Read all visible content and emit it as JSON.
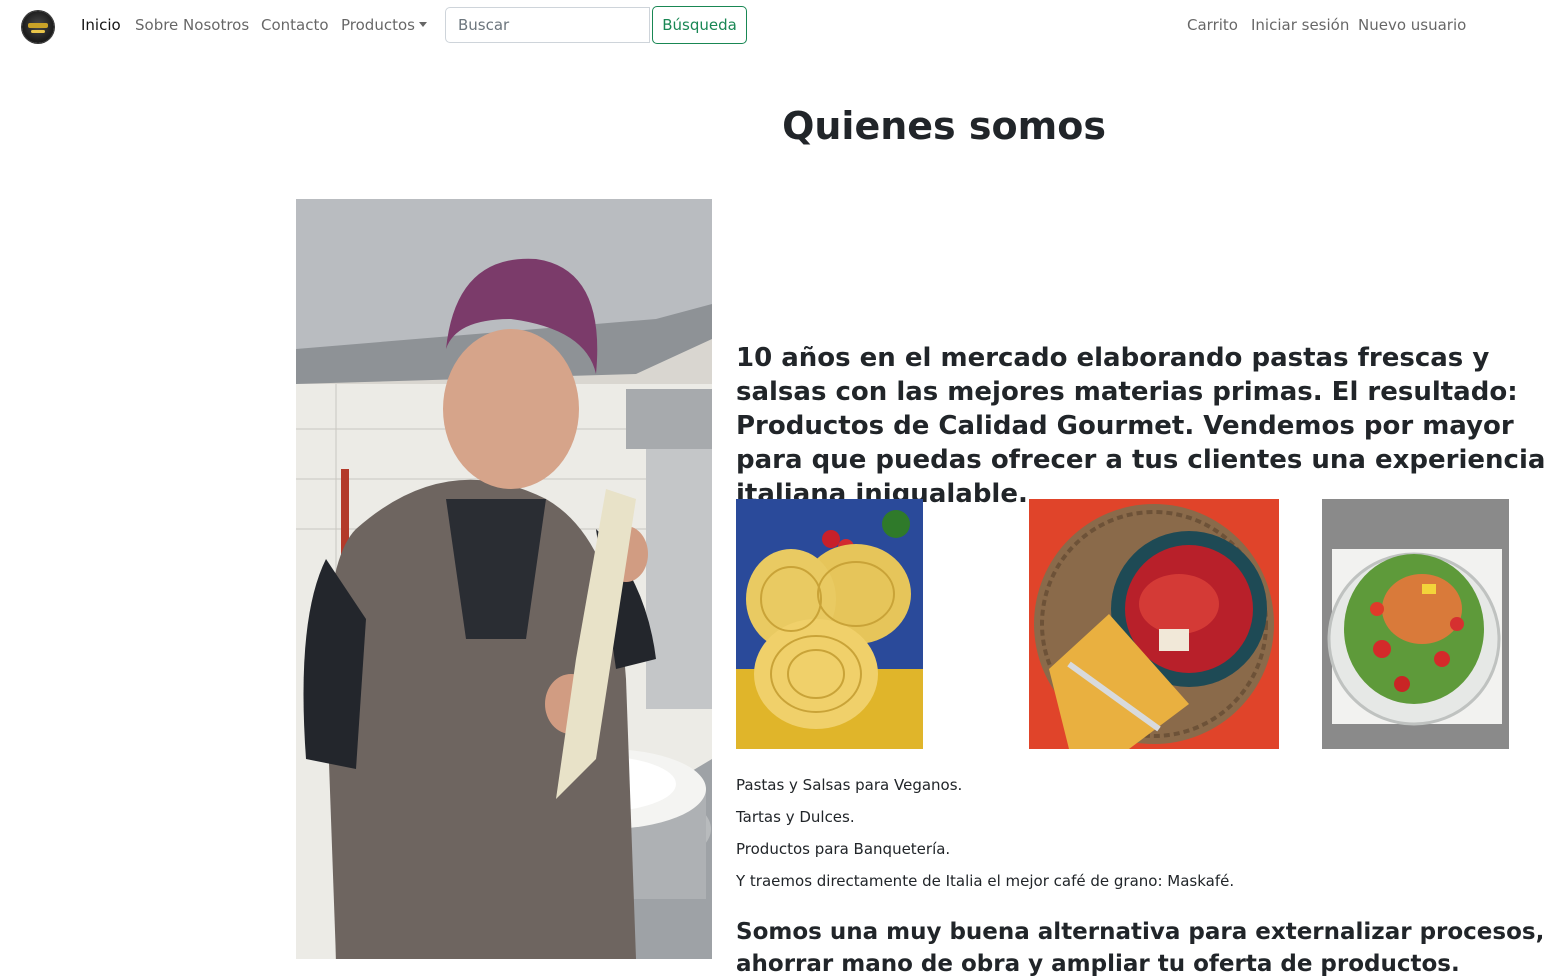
{
  "navbar": {
    "brand_logo_icon": "pasta-brand-logo",
    "links": {
      "home": "Inicio",
      "about": "Sobre Nosotros",
      "contact": "Contacto",
      "products": "Productos"
    },
    "search": {
      "placeholder": "Buscar",
      "button": "Búsqueda"
    },
    "right_links": {
      "cart": "Carrito",
      "login": "Iniciar sesión",
      "register": "Nuevo usuario"
    }
  },
  "page": {
    "title": "Quienes somos",
    "lead": "10 años en el mercado elaborando pastas frescas y salsas con las mejores materias primas. El resultado: Productos de Calidad Gourmet. Vendemos por mayor para que puedas ofrecer a tus clientes una experiencia italiana inigualable.",
    "lines": [
      "Pastas y Salsas para Veganos.",
      "Tartas y Dulces.",
      "Productos para Banquetería.",
      "Y traemos directamente de Italia el mejor café de grano: Maskafé."
    ],
    "bottom_text": "Somos una muy buena alternativa para externalizar procesos, ahorrar mano de obra y ampliar tu oferta de productos."
  },
  "colors": {
    "success": "#198754",
    "text": "#212529",
    "muted_link": "rgba(0,0,0,0.6)"
  }
}
